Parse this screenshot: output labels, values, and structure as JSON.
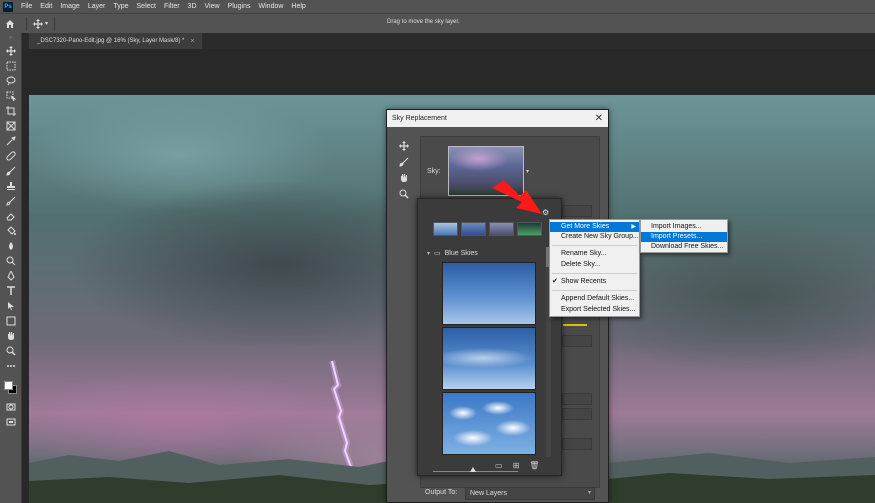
{
  "menubar": {
    "logo": "Ps",
    "items": [
      "File",
      "Edit",
      "Image",
      "Layer",
      "Type",
      "Select",
      "Filter",
      "3D",
      "View",
      "Plugins",
      "Window",
      "Help"
    ]
  },
  "options": {
    "hint": "Drag to move the sky layer."
  },
  "document": {
    "tab_title": "_DSC7320-Pano-Edit.jpg @ 16% (Sky, Layer Mask/8) *",
    "close_glyph": "×"
  },
  "dialog": {
    "title": "Sky Replacement",
    "close_glyph": "✕",
    "sky_label": "Sky:",
    "output_label": "Output To:",
    "output_value": "New Layers"
  },
  "picker": {
    "group_name": "Blue Skies"
  },
  "context_menu": {
    "items": [
      {
        "label": "Get More Skies",
        "highlighted": true,
        "submenu": true
      },
      {
        "label": "Create New Sky Group..."
      },
      {
        "label": "Rename Sky..."
      },
      {
        "label": "Delete Sky..."
      },
      {
        "label": "Show Recents",
        "checked": true
      },
      {
        "label": "Append Default Skies..."
      },
      {
        "label": "Export Selected Skies..."
      }
    ]
  },
  "submenu": {
    "items": [
      {
        "label": "Import Images..."
      },
      {
        "label": "Import Presets...",
        "highlighted": true
      },
      {
        "label": "Download Free Skies..."
      }
    ]
  },
  "colors": {
    "highlight": "#0078d7",
    "annotation_arrow": "#ff1a1a",
    "slider_accent": "#d8c200"
  }
}
